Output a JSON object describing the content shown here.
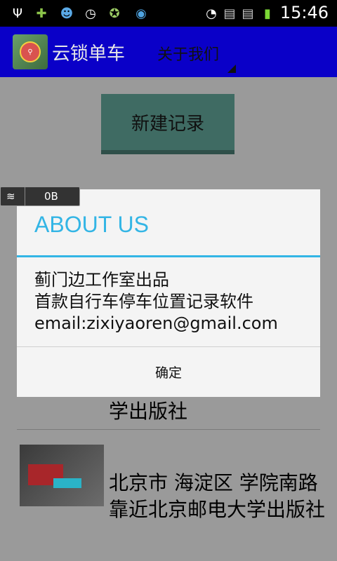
{
  "status_bar": {
    "time": "15:46",
    "left_icons": [
      "usb-icon",
      "game-icon",
      "chat-icon",
      "clock-icon",
      "app-icon",
      "hotspot-icon"
    ],
    "right_icons": [
      "wifi-icon",
      "sim1-icon",
      "sim2-icon",
      "battery-icon"
    ]
  },
  "action_bar": {
    "app_title": "云锁单车",
    "about_tab": "关于我们",
    "colors": {
      "background": "#0a00c8"
    }
  },
  "main": {
    "new_record_button": "新建记录",
    "list": [
      {
        "address_visible": "学出版社"
      },
      {
        "address": "北京市 海淀区 学院南路 靠近北京邮电大学出版社"
      }
    ]
  },
  "traffic_widget": {
    "value": "0B"
  },
  "dialog": {
    "title": "ABOUT US",
    "lines": [
      "蓟门边工作室出品",
      "首款自行车停车位置记录软件",
      "email:zixiyaoren@gmail.com"
    ],
    "ok_button": "确定",
    "accent_color": "#33b5e5"
  }
}
